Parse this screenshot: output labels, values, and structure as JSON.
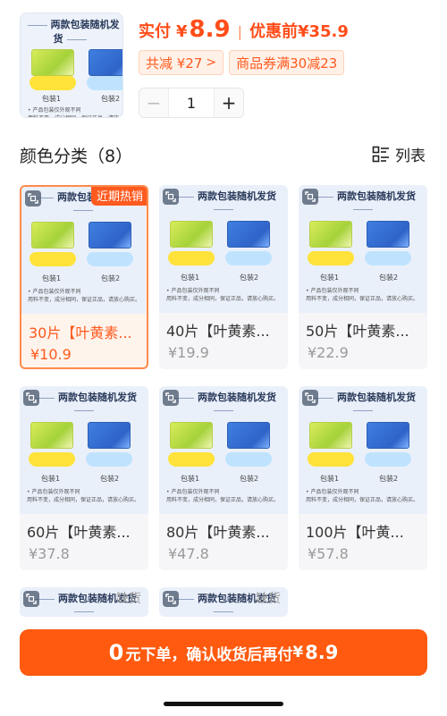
{
  "header": {
    "thumb_banner": "两款包装随机发货",
    "price_label": "实付",
    "currency": "¥",
    "price_value": "8.9",
    "separator": "|",
    "original_label": "优惠前",
    "original_price": "¥35.9",
    "discount_chip": "共减 ¥27",
    "discount_chevron": ">",
    "coupon_chip": "商品券满30减23",
    "quantity": "1",
    "minus": "−",
    "plus": "+"
  },
  "section": {
    "title": "颜色分类（8）",
    "list_label": "列表"
  },
  "product_image": {
    "banner": "两款包装随机发货",
    "pack1": "包装1",
    "pack2": "包装2",
    "note_line1": "• 产品包装仅外观不同",
    "note_line2": "用料不变，成分相同，保证正品，请放心购买。"
  },
  "skus": [
    {
      "name": "30片【叶黄素...",
      "price": "¥10.9",
      "badge": "近期热销",
      "selected": true
    },
    {
      "name": "40片【叶黄素...",
      "price": "¥19.9"
    },
    {
      "name": "50片【叶黄素...",
      "price": "¥22.9"
    },
    {
      "name": "60片【叶黄素...",
      "price": "¥37.8"
    },
    {
      "name": "80片【叶黄素...",
      "price": "¥47.8"
    },
    {
      "name": "100片【叶黄...",
      "price": "¥57.8"
    },
    {
      "name": "",
      "price": "",
      "badge": "缺货"
    },
    {
      "name": "",
      "price": "",
      "badge": "缺货"
    }
  ],
  "bottom_bar": {
    "zero": "0",
    "text": "元下单，确认收货后再付",
    "currency": "¥",
    "amount": "8.9"
  },
  "colors": {
    "accent": "#ff5a0f",
    "price_red": "#ff4d1a",
    "chip_bg": "#fff1e8"
  },
  "icons": [
    "zoom-icon",
    "list-view-icon",
    "chevron-right-icon"
  ]
}
